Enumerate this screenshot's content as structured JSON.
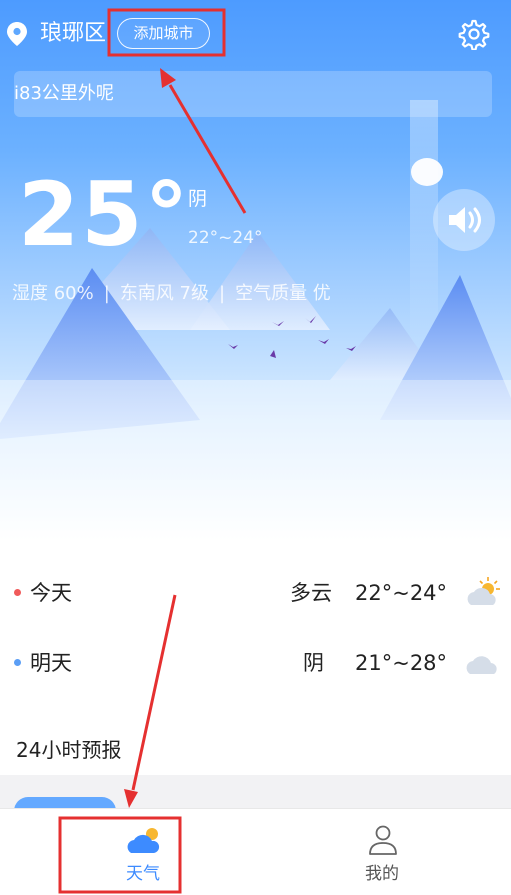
{
  "header": {
    "city": "琅琊区",
    "add_city_label": "添加城市",
    "location_icon": "location-pin-icon",
    "settings_icon": "gear-icon"
  },
  "notice": {
    "text": "i83公里外呢"
  },
  "current": {
    "temperature": "25°",
    "condition": "阴",
    "range": "22°~24°",
    "humidity": "湿度 60%",
    "wind": "东南风 7级",
    "air_quality": "空气质量 优",
    "stat_separator": "|",
    "speaker_icon": "speaker-icon"
  },
  "days": [
    {
      "label": "今天",
      "condition": "多云",
      "range": "22°~24°",
      "dot_color": "#f05a5a",
      "icon": "partly-cloudy-icon"
    },
    {
      "label": "明天",
      "condition": "阴",
      "range": "21°~28°",
      "dot_color": "#5b9ef5",
      "icon": "cloud-icon"
    }
  ],
  "forecast": {
    "title": "24小时预报"
  },
  "tabs": [
    {
      "label": "天气",
      "icon": "weather-icon",
      "active": true
    },
    {
      "label": "我的",
      "icon": "user-icon",
      "active": false
    }
  ],
  "colors": {
    "accent": "#3d8bff",
    "tab_active": "#3d8bff",
    "tab_inactive": "#555555",
    "annotation": "#e53030"
  }
}
